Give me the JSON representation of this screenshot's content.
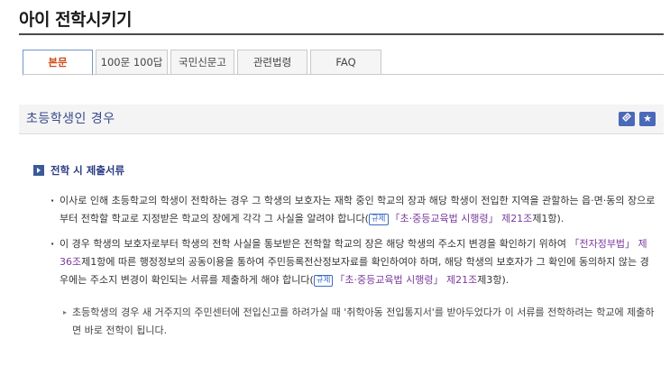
{
  "page": {
    "title": "아이 전학시키기"
  },
  "tabs": [
    {
      "label": "본문",
      "active": true
    },
    {
      "label": "100문 100답",
      "active": false
    },
    {
      "label": "국민신문고",
      "active": false
    },
    {
      "label": "관련법령",
      "active": false
    },
    {
      "label": "FAQ",
      "active": false
    }
  ],
  "section": {
    "title": "초등학생인 경우",
    "link_icon": "link-icon",
    "bookmark_icon": "star-icon"
  },
  "subsection": {
    "heading": "전학 시 제출서류"
  },
  "paragraphs": {
    "p1_text": "이사로 인해 초등학교의 학생이 전학하는 경우 그 학생의 보호자는 재학 중인 학교의 장과 해당 학생이 전입한 지역을 관할하는 읍·면·동의 장으로부터 전학할 학교로 지정받은 학교의 장에게 각각 그 사실을 알려야 합니다(",
    "p1_tag": "규제",
    "p1_law": "「초·중등교육법 시행령」 제21조",
    "p1_end": "제1항).",
    "p2_text": "이 경우 학생의 보호자로부터 학생의 전학 사실을 통보받은 전학할 학교의 장은 해당 학생의 주소지 변경을 확인하기 위하여 ",
    "p2_law1": "「전자정부법」 제36조",
    "p2_mid": "제1항에 따른 행정정보의 공동이용을 통하여 주민등록전산정보자료를 확인하여야 하며, 해당 학생의 보호자가 그 확인에 동의하지 않는 경우에는 주소지 변경이 확인되는 서류를 제출하게 해야 합니다(",
    "p2_tag": "규제",
    "p2_law2": "「초·중등교육법 시행령」 제21조",
    "p2_end": "제3항).",
    "note": "초등학생의 경우 새 거주지의 주민센터에 전입신고를 하려가실 때 '취학아동 전입통지서'를 받아두었다가 이 서류를 전학하려는 학교에 제출하면 바로 전학이 됩니다."
  },
  "colors": {
    "accent": "#4a69b8",
    "active_tab": "#d24b1a",
    "law": "#7a3a9c"
  }
}
